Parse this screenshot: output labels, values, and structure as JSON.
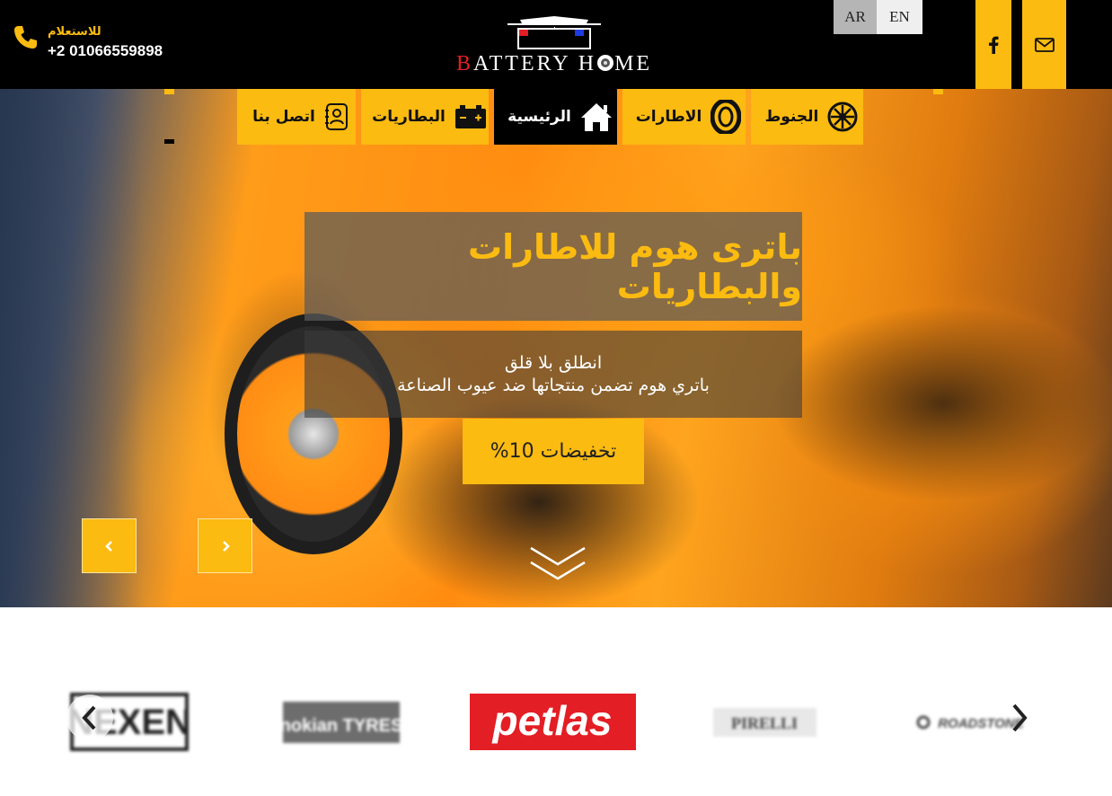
{
  "header": {
    "phone_label": "للاستعلام",
    "phone_number": "+2 01066559898",
    "logo_text_1": "B",
    "logo_text_2": "ATTERY H",
    "logo_text_3": "ME",
    "languages": [
      "AR",
      "EN"
    ],
    "social": [
      "facebook-icon",
      "envelope-icon"
    ]
  },
  "nav": {
    "items": [
      {
        "label": "اتصل بنا",
        "icon": "contact-book-icon"
      },
      {
        "label": "البطاريات",
        "icon": "battery-icon"
      },
      {
        "label": "الرئيسية",
        "icon": "home-icon",
        "active": true
      },
      {
        "label": "الاطارات",
        "icon": "tyre-icon"
      },
      {
        "label": "الجنوط",
        "icon": "rim-icon"
      }
    ]
  },
  "hero": {
    "title": "باترى هوم للاطارات والبطاريات",
    "subtitle_line1": "انطلق بلا قلق",
    "subtitle_line2": "باتري هوم تضمن منتجاتها ضد عيوب الصناعة",
    "discount_label": "تخفيضات 10%",
    "prev_symbol": "‹",
    "next_symbol": "›"
  },
  "brands": {
    "items": [
      {
        "name": "NEXEN"
      },
      {
        "name": "nokian TYRES"
      },
      {
        "name": "petlas"
      },
      {
        "name": "PIRELLI"
      },
      {
        "name": "ROADSTONE"
      }
    ],
    "prev_symbol": "‹",
    "next_symbol": "›"
  },
  "colors": {
    "accent": "#fbbb10",
    "topbar": "#000000",
    "petlas_red": "#e31e24"
  }
}
